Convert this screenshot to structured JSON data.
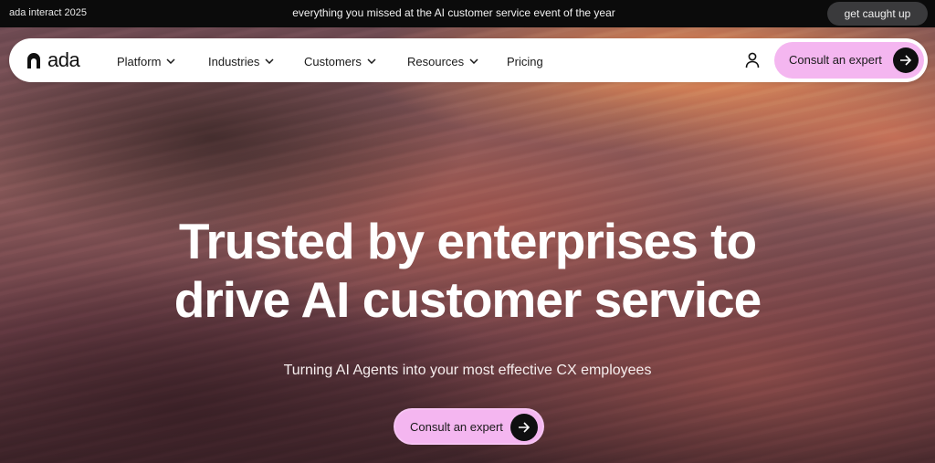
{
  "announcement": {
    "left_text": "ada interact 2025",
    "center_text": "everything you missed at the AI customer service event of the year",
    "cta_label": "get caught up"
  },
  "nav": {
    "logo_text": "ada",
    "items": [
      {
        "label": "Platform",
        "has_dropdown": true
      },
      {
        "label": "Industries",
        "has_dropdown": true
      },
      {
        "label": "Customers",
        "has_dropdown": true
      },
      {
        "label": "Resources",
        "has_dropdown": true
      },
      {
        "label": "Pricing",
        "has_dropdown": false
      }
    ],
    "user_icon": "user-icon",
    "cta_label": "Consult an expert",
    "cta_icon": "arrow-right-icon"
  },
  "hero": {
    "headline_line1": "Trusted by enterprises to",
    "headline_line2": "drive AI customer service",
    "subtitle": "Turning AI Agents into your most effective CX employees",
    "cta_label": "Consult an expert",
    "cta_icon": "arrow-right-icon"
  },
  "colors": {
    "accent_pink": "#f4b6f0",
    "dark": "#0f0f10",
    "announce_bg": "#0b0b0b"
  }
}
